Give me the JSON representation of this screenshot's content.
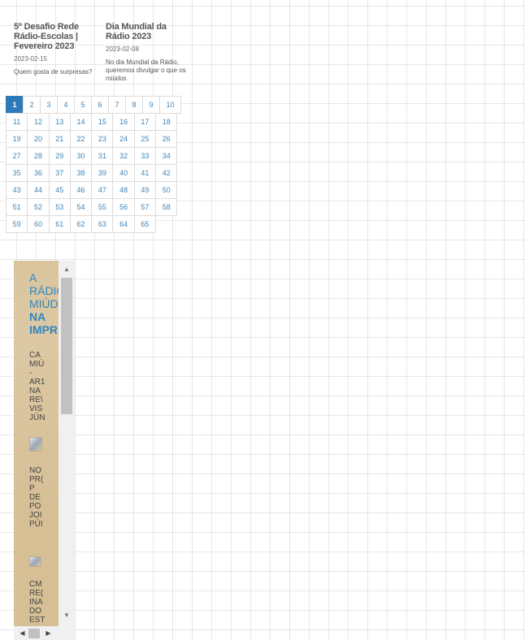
{
  "posts": [
    {
      "title": "5º Desafio Rede Rádio-Escolas | Fevereiro 2023",
      "date": "2023-02-15",
      "excerpt": "Quem gosta de surpresas?"
    },
    {
      "title": "Dia Mundial da Rádio 2023",
      "date": "2023-02-08",
      "excerpt": "No dia Mundial da Rádio, queremos divulgar o que os miúdos"
    }
  ],
  "pagination": {
    "active": "1",
    "rows": [
      [
        "1",
        "2",
        "3",
        "4",
        "5",
        "6",
        "7",
        "8",
        "9",
        "10"
      ],
      [
        "11",
        "12",
        "13",
        "14",
        "15",
        "16",
        "17",
        "18"
      ],
      [
        "19",
        "20",
        "21",
        "22",
        "23",
        "24",
        "25",
        "26"
      ],
      [
        "27",
        "28",
        "29",
        "30",
        "31",
        "32",
        "33",
        "34"
      ],
      [
        "35",
        "36",
        "37",
        "38",
        "39",
        "40",
        "41",
        "42"
      ],
      [
        "43",
        "44",
        "45",
        "46",
        "47",
        "48",
        "49",
        "50"
      ],
      [
        "51",
        "52",
        "53",
        "54",
        "55",
        "56",
        "57",
        "58"
      ],
      [
        "59",
        "60",
        "61",
        "62",
        "63",
        "64",
        "65"
      ]
    ]
  },
  "feed": {
    "title_line1": "A",
    "title_line2": "RÁDIO",
    "title_line3": "MIÚDOS",
    "title_line4": "NA",
    "title_line5": "IMPRENSA",
    "item1_text": "CA\nMIÚ\n-\nAR1\nNA\nRE\\\nVIS\nJÚN",
    "item2_text": "NO\nPR(\nP\nDE\nPO\nJOI\nPÚI",
    "item3_text": "CM\nRE(\nINA\nDO\nEST"
  },
  "colors": {
    "accent": "#2e7ab8",
    "link": "#3f84b7",
    "feed_bg": "#d6bf95",
    "feed_title": "#2e86c1"
  },
  "icons": {
    "scroll_up": "▲",
    "scroll_down": "▼",
    "scroll_left": "◀",
    "scroll_right": "▶"
  }
}
